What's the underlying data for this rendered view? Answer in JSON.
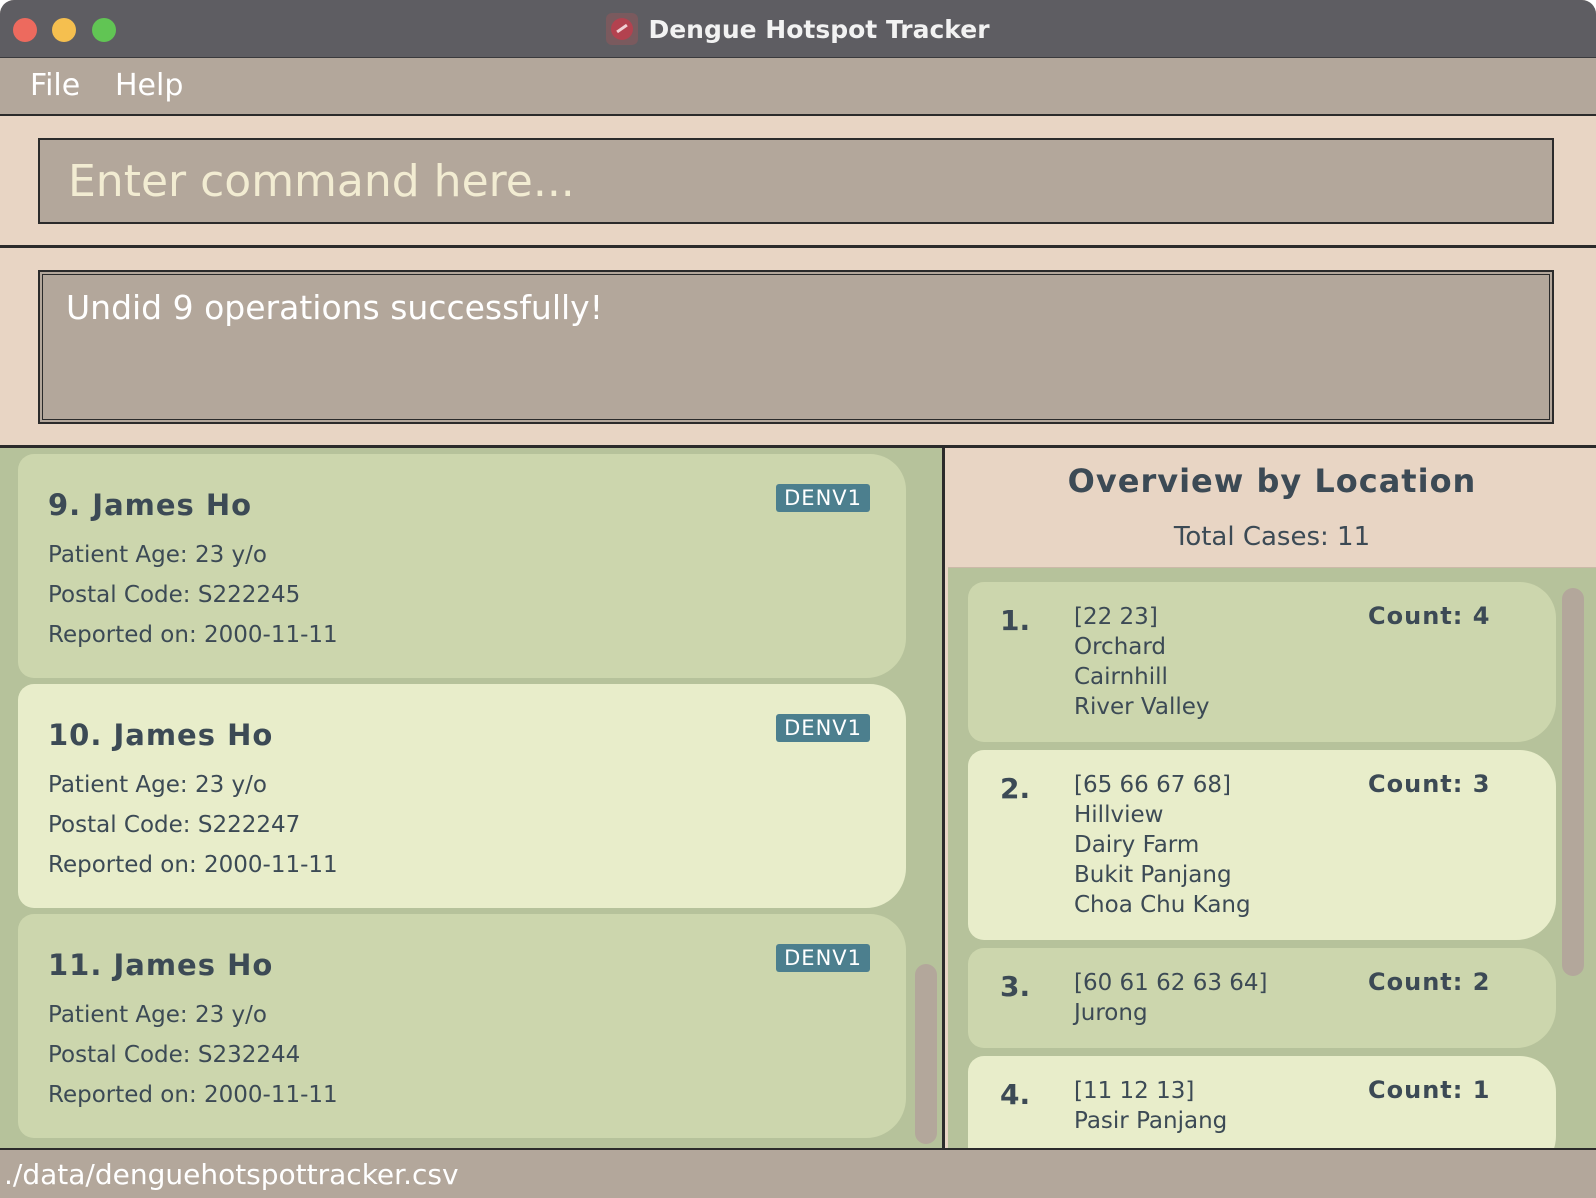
{
  "window": {
    "title": "Dengue Hotspot Tracker",
    "icon": "app-logo-icon"
  },
  "menu": {
    "file": "File",
    "help": "Help"
  },
  "command": {
    "placeholder": "Enter command here...",
    "value": ""
  },
  "result": {
    "message": "Undid 9 operations successfully!"
  },
  "cases": [
    {
      "name": "9. James Ho",
      "variant": "DENV1",
      "age": "Patient Age: 23 y/o",
      "postal": "Postal Code: S222245",
      "date": "Reported on: 2000-11-11"
    },
    {
      "name": "10. James Ho",
      "variant": "DENV1",
      "age": "Patient Age: 23 y/o",
      "postal": "Postal Code: S222247",
      "date": "Reported on: 2000-11-11"
    },
    {
      "name": "11. James Ho",
      "variant": "DENV1",
      "age": "Patient Age: 23 y/o",
      "postal": "Postal Code: S232244",
      "date": "Reported on: 2000-11-11"
    }
  ],
  "overview": {
    "title": "Overview by Location",
    "total": "Total Cases: 11",
    "items": [
      {
        "index": "1.",
        "code": "[22 23]",
        "locations": [
          "Orchard",
          "Cairnhill",
          "River Valley"
        ],
        "count": "Count: 4"
      },
      {
        "index": "2.",
        "code": "[65 66 67 68]",
        "locations": [
          "Hillview",
          "Dairy Farm",
          "Bukit Panjang",
          "Choa Chu Kang"
        ],
        "count": "Count: 3"
      },
      {
        "index": "3.",
        "code": "[60 61 62 63 64]",
        "locations": [
          "Jurong"
        ],
        "count": "Count: 2"
      },
      {
        "index": "4.",
        "code": "[11 12 13]",
        "locations": [
          "Pasir Panjang"
        ],
        "count": "Count: 1"
      }
    ]
  },
  "status": {
    "filepath": "./data/denguehotspottracker.csv"
  },
  "colors": {
    "titlebar": "#5e5d62",
    "menubar": "#b3a79b",
    "panel_bg": "#e8d5c4",
    "card_dark": "#ccd6ad",
    "card_light": "#e8edca",
    "badge": "#4c7f8e",
    "text": "#3c4a55"
  }
}
